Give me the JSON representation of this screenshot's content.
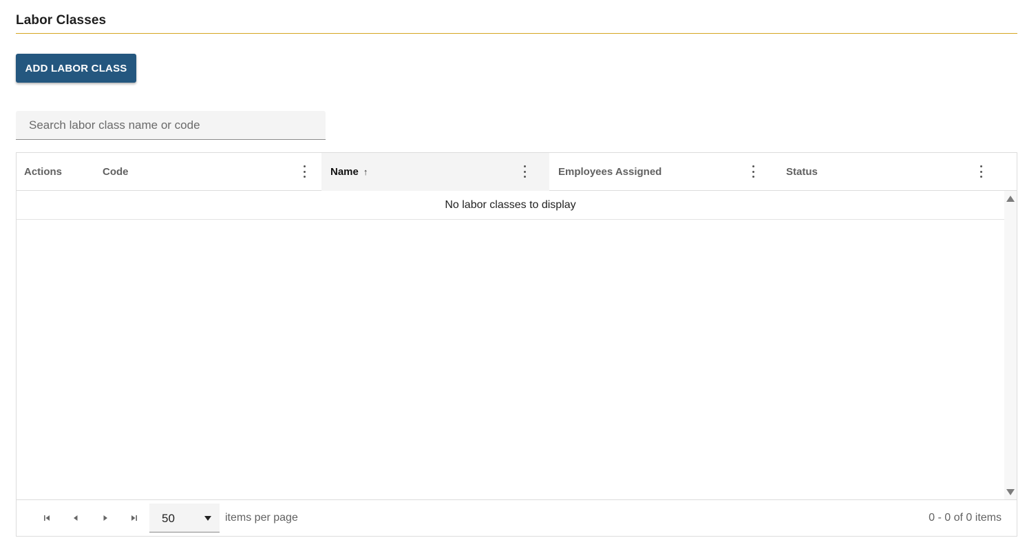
{
  "page": {
    "title": "Labor Classes",
    "accent_color": "#d6a520"
  },
  "toolbar": {
    "add_label": "ADD LABOR CLASS",
    "add_color": "#24577f"
  },
  "search": {
    "placeholder": "Search labor class name or code",
    "value": ""
  },
  "grid": {
    "columns": [
      {
        "label": "Actions",
        "has_menu": false,
        "sorted": false
      },
      {
        "label": "Code",
        "has_menu": true,
        "sorted": false
      },
      {
        "label": "Name",
        "has_menu": true,
        "sorted": true,
        "sort_direction": "ascending"
      },
      {
        "label": "Employees Assigned",
        "has_menu": true,
        "sorted": false
      },
      {
        "label": "Status",
        "has_menu": true,
        "sorted": false
      }
    ],
    "sort_icon": "arrow-up-icon",
    "empty_message": "No labor classes to display",
    "rows": []
  },
  "pager": {
    "page_size": "50",
    "per_page_label": "items per page",
    "info": "0 - 0 of 0 items"
  }
}
